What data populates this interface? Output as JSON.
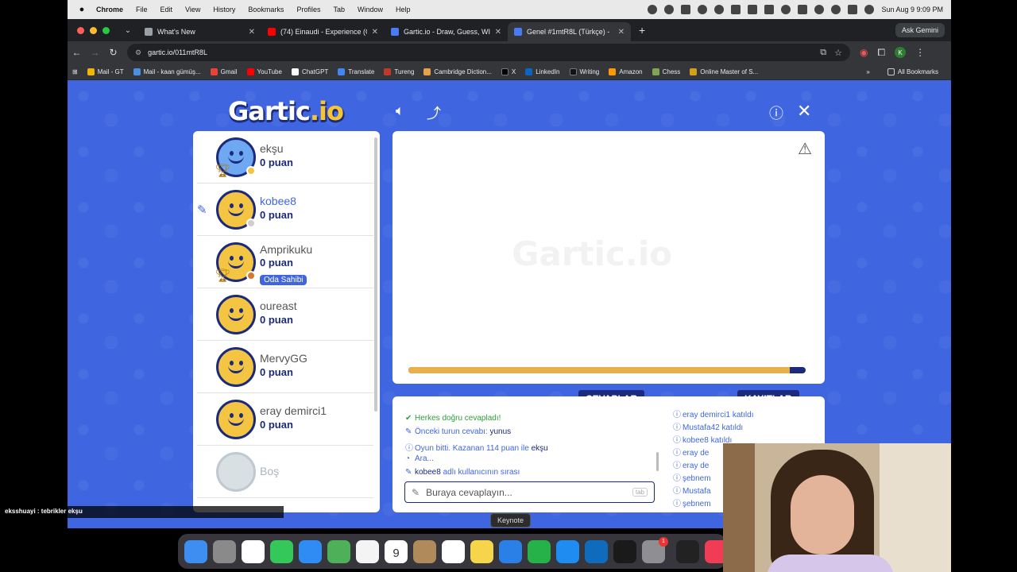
{
  "menubar": {
    "app_name": "Chrome",
    "items": [
      "File",
      "Edit",
      "View",
      "History",
      "Bookmarks",
      "Profiles",
      "Tab",
      "Window",
      "Help"
    ],
    "clock": "Sun Aug 9  9:09 PM"
  },
  "tabs": [
    {
      "title": "What's New",
      "color": "#9aa0a6"
    },
    {
      "title": "(74) Einaudi - Experience (Co",
      "color": "#ff0000"
    },
    {
      "title": "Gartic.io - Draw, Guess, WIN",
      "color": "#4a7bf7"
    },
    {
      "title": "Genel #1mtR8L (Türkçe) -",
      "color": "#4a7bf7"
    }
  ],
  "gemini_button": "Ask Gemini",
  "address": {
    "url": "gartic.io/011mtR8L"
  },
  "avatar_letter": "K",
  "bookmarks": [
    {
      "label": "Mail - GT",
      "color": "#f2b500"
    },
    {
      "label": "Mail - kaan gümüş...",
      "color": "#4a90e2"
    },
    {
      "label": "Gmail",
      "color": "#ea4335"
    },
    {
      "label": "YouTube",
      "color": "#ff0000"
    },
    {
      "label": "ChatGPT",
      "color": "#ffffff"
    },
    {
      "label": "Translate",
      "color": "#4285f4"
    },
    {
      "label": "Tureng",
      "color": "#c0392b"
    },
    {
      "label": "Cambridge Diction...",
      "color": "#e5a04a"
    },
    {
      "label": "X",
      "color": "#000000"
    },
    {
      "label": "LinkedIn",
      "color": "#0a66c2"
    },
    {
      "label": "Writing",
      "color": "#111111"
    },
    {
      "label": "Amazon",
      "color": "#ff9900"
    },
    {
      "label": "Chess",
      "color": "#7fa650"
    },
    {
      "label": "Online Master of S...",
      "color": "#d4a017"
    }
  ],
  "all_bookmarks": "All Bookmarks",
  "game": {
    "logo_text": "Gartic",
    "logo_suffix": ".io",
    "players": [
      {
        "name": "ekşu",
        "points": "0 puan",
        "trophy": true,
        "status_color": "#f4c542",
        "avatar": "blue"
      },
      {
        "name": "kobee8",
        "points": "0 puan",
        "drawing": true,
        "status_color": "#cfcfcf",
        "avatar": "yellow"
      },
      {
        "name": "Amprikuku",
        "points": "0 puan",
        "trophy": true,
        "badge": "Oda Sahibi",
        "status_color": "#d9772f",
        "avatar": "yellow"
      },
      {
        "name": "oureast",
        "points": "0 puan",
        "avatar": "yellow"
      },
      {
        "name": "MervyGG",
        "points": "0 puan",
        "avatar": "yellow"
      },
      {
        "name": "eray demirci1",
        "points": "0 puan",
        "avatar": "yellow"
      }
    ],
    "empty_slot": "Boş",
    "timer_fraction": 0.96,
    "tab_answers": "CEVAPLAR",
    "tab_chat": "KAYITLAR",
    "answers_log": [
      {
        "icon": "✔",
        "text": "Herkes doğru cevapladı!",
        "style": "green"
      },
      {
        "icon": "✎",
        "text": "Önceki turun cevabı:",
        "highlight": "yunus"
      },
      {
        "icon": "ⓘ",
        "text": "Oyun bitti. Kazanan 114 puan ile",
        "highlight": "ekşu"
      },
      {
        "icon": "◔",
        "text": "Ara..."
      },
      {
        "icon": "✎",
        "highlight_first": "kobee8",
        "text": "adlı kullanıcının sırası"
      }
    ],
    "answer_placeholder": "Buraya cevaplayın...",
    "tab_key": "tab",
    "chat_log": [
      {
        "name": "eray demirci1",
        "text": "katıldı"
      },
      {
        "name": "Mustafa42",
        "text": "katıldı"
      },
      {
        "name": "kobee8",
        "text": "katıldı"
      },
      {
        "name": "eray de",
        "text": ""
      },
      {
        "name": "eray de",
        "text": ""
      },
      {
        "name": "şebnem",
        "text": ""
      },
      {
        "name": "Mustafa",
        "text": ""
      },
      {
        "name": "şebnem",
        "text": ""
      }
    ]
  },
  "stream_caption": "eksshuayi : tebrikler ekşu",
  "dock": {
    "tooltip": "Keynote",
    "calendar_day": "9",
    "calendar_month": "AUG",
    "notification_count": "1",
    "apps": [
      {
        "name": "finder",
        "color": "#3d8ef0"
      },
      {
        "name": "launchpad",
        "color": "#8a8a8a"
      },
      {
        "name": "opera",
        "color": "#ffffff"
      },
      {
        "name": "messages",
        "color": "#34c759"
      },
      {
        "name": "safari",
        "color": "#2f8cf5"
      },
      {
        "name": "maps",
        "color": "#4fb05a"
      },
      {
        "name": "photos",
        "color": "#f4f4f4"
      },
      {
        "name": "calendar",
        "color": "#ffffff"
      },
      {
        "name": "contacts",
        "color": "#b08a5a"
      },
      {
        "name": "reminders",
        "color": "#ffffff"
      },
      {
        "name": "notes",
        "color": "#f7d54a"
      },
      {
        "name": "keynote",
        "color": "#2b80e8"
      },
      {
        "name": "numbers",
        "color": "#27b149"
      },
      {
        "name": "app-store",
        "color": "#1e8cf0"
      },
      {
        "name": "outlook",
        "color": "#0f6cbd"
      },
      {
        "name": "terminal",
        "color": "#1a1a1a"
      },
      {
        "name": "system-settings",
        "color": "#8e8e93"
      },
      {
        "name": "obs",
        "color": "#222222"
      },
      {
        "name": "music",
        "color": "#f03c55"
      }
    ]
  }
}
